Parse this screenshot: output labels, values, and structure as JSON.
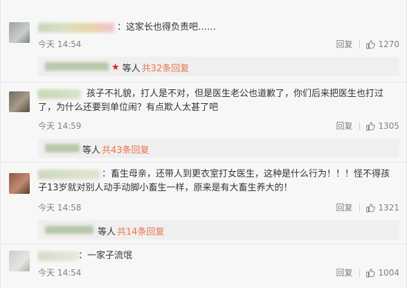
{
  "comments": [
    {
      "text": "：这家长也得负责吧……",
      "time": "今天 14:54",
      "reply_label": "回复",
      "likes": "1270"
    },
    {
      "text": "孩子不礼貌，打人是不对，但是医生老公也道歉了，你们后来把医生也打过了，为什么还要到单位闹？有点欺人太甚了吧",
      "time": "今天 14:59",
      "reply_label": "回复",
      "likes": "1305"
    },
    {
      "text": "：畜生母亲，还带人到更衣室打女医生，这种是什么行为！！！怪不得孩子13岁就对别人动手动脚小畜生一样，原来是有大畜生养大的！",
      "time": "今天 14:58",
      "reply_label": "回复",
      "likes": "1321"
    },
    {
      "text": "：一家子流氓",
      "time": "今天 14:54",
      "reply_label": "回复",
      "likes": "1004"
    }
  ],
  "reply_bars": [
    {
      "prefix": "等人",
      "link": "共32条回复",
      "starred": true
    },
    {
      "prefix": "等人",
      "link": "共43条回复",
      "starred": false
    },
    {
      "prefix": "等人",
      "link": "共14条回复",
      "starred": false
    }
  ],
  "icons": {
    "like": "thumbs-up-icon",
    "verified": "red-star-icon"
  },
  "colors": {
    "link": "#eb7350",
    "star": "#e0231b",
    "meta": "#808080"
  }
}
